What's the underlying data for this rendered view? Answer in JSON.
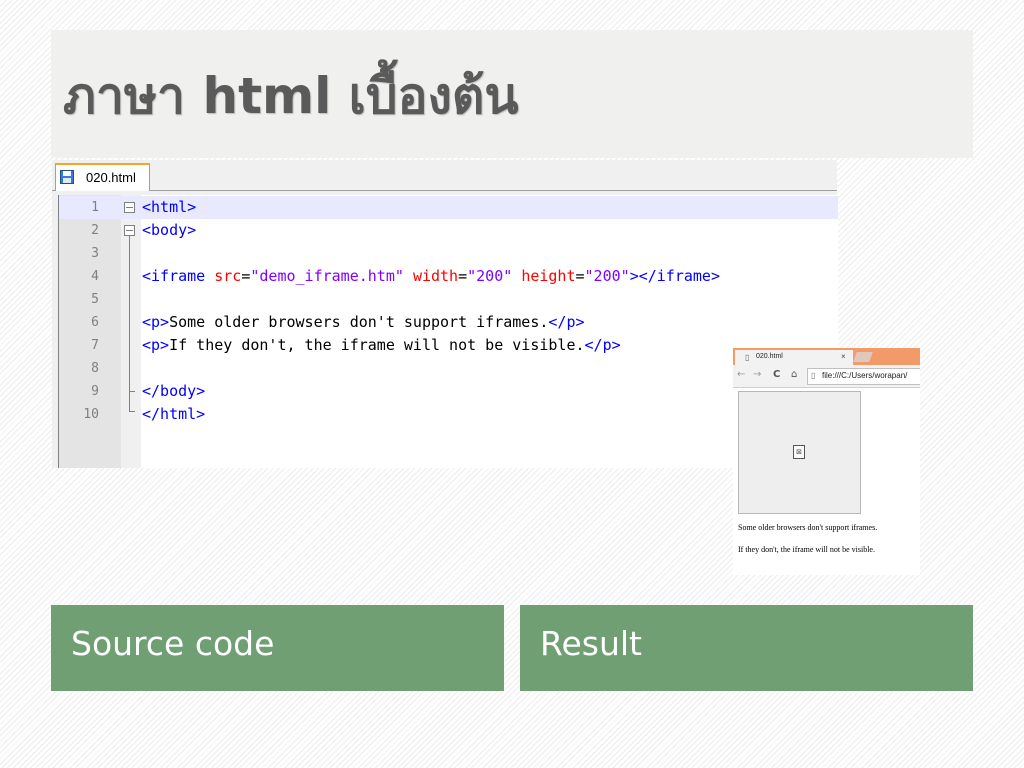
{
  "slide": {
    "title": "ภาษา html เบื้องต้น"
  },
  "editor": {
    "tab_label": "020.html",
    "lines": [
      {
        "num": "1",
        "parts": [
          {
            "cls": "tag",
            "text": "<html>"
          }
        ]
      },
      {
        "num": "2",
        "parts": [
          {
            "cls": "tag",
            "text": "<body>"
          }
        ]
      },
      {
        "num": "3",
        "parts": []
      },
      {
        "num": "4",
        "parts": [
          {
            "cls": "tag",
            "text": "<iframe "
          },
          {
            "cls": "attr",
            "text": "src"
          },
          {
            "cls": "txt",
            "text": "="
          },
          {
            "cls": "val",
            "text": "\"demo_iframe.htm\""
          },
          {
            "cls": "txt",
            "text": " "
          },
          {
            "cls": "attr",
            "text": "width"
          },
          {
            "cls": "txt",
            "text": "="
          },
          {
            "cls": "val",
            "text": "\"200\""
          },
          {
            "cls": "txt",
            "text": " "
          },
          {
            "cls": "attr",
            "text": "height"
          },
          {
            "cls": "txt",
            "text": "="
          },
          {
            "cls": "val",
            "text": "\"200\""
          },
          {
            "cls": "tag",
            "text": "></iframe>"
          }
        ]
      },
      {
        "num": "5",
        "parts": []
      },
      {
        "num": "6",
        "parts": [
          {
            "cls": "tag",
            "text": "<p>"
          },
          {
            "cls": "txt",
            "text": "Some older browsers don't support iframes."
          },
          {
            "cls": "tag",
            "text": "</p>"
          }
        ]
      },
      {
        "num": "7",
        "parts": [
          {
            "cls": "tag",
            "text": "<p>"
          },
          {
            "cls": "txt",
            "text": "If they don't, the iframe will not be visible."
          },
          {
            "cls": "tag",
            "text": "</p>"
          }
        ]
      },
      {
        "num": "8",
        "parts": []
      },
      {
        "num": "9",
        "parts": [
          {
            "cls": "tag",
            "text": "</body>"
          }
        ]
      },
      {
        "num": "10",
        "parts": [
          {
            "cls": "tag",
            "text": "</html>"
          }
        ]
      }
    ]
  },
  "browser": {
    "tab_title": "020.html",
    "tab_close": "×",
    "url": "file:///C:/Users/worapan/",
    "text_line1": "Some older browsers don't support iframes.",
    "text_line2": "If they don't, the iframe will not be visible."
  },
  "captions": {
    "left": "Source code",
    "right": "Result"
  },
  "colors": {
    "caption_bg": "#6f9f73",
    "title_bar_bg": "#f0f0ef",
    "tag": "#0000ff",
    "attr": "#ff0000",
    "value": "#8000ff",
    "browser_tabstrip": "#f39a6b"
  },
  "icons": {
    "save": "floppy-disk-icon",
    "back": "arrow-left-icon",
    "forward": "arrow-right-icon",
    "reload": "reload-icon",
    "home": "home-icon",
    "page": "page-icon",
    "broken_image": "broken-image-icon"
  }
}
